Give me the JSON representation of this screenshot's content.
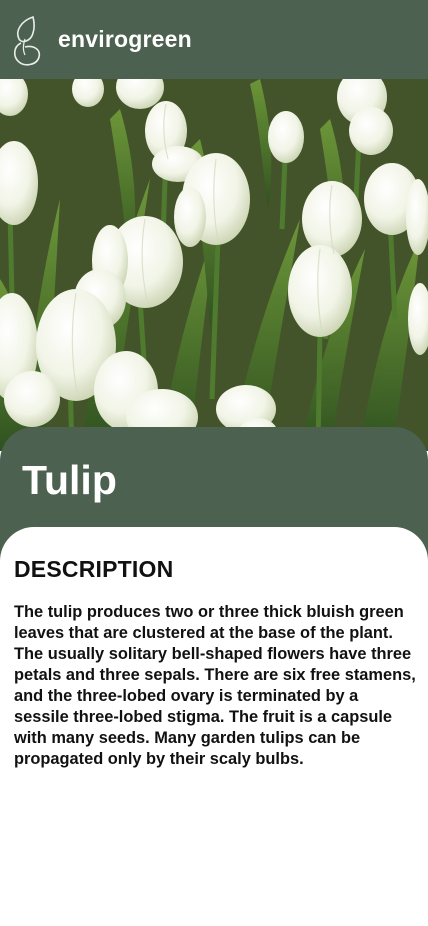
{
  "header": {
    "app_name": "envirogreen",
    "logo_icon": "leaf-outline-icon",
    "background_color": "#4c6150"
  },
  "hero": {
    "image_subject": "white tulips field photo"
  },
  "plant": {
    "name": "Tulip"
  },
  "description": {
    "heading": "DESCRIPTION",
    "body": "The tulip produces two or three thick bluish green leaves that are clustered at the base of the plant. The usually solitary bell-shaped flowers have three petals and three sepals. There are six free stamens, and the three-lobed ovary is terminated by a sessile three-lobed stigma. The fruit is a capsule with many seeds. Many garden tulips can be propagated only by their scaly bulbs."
  },
  "colors": {
    "brand_green": "#4c6150",
    "text": "#111111",
    "card": "#ffffff"
  }
}
